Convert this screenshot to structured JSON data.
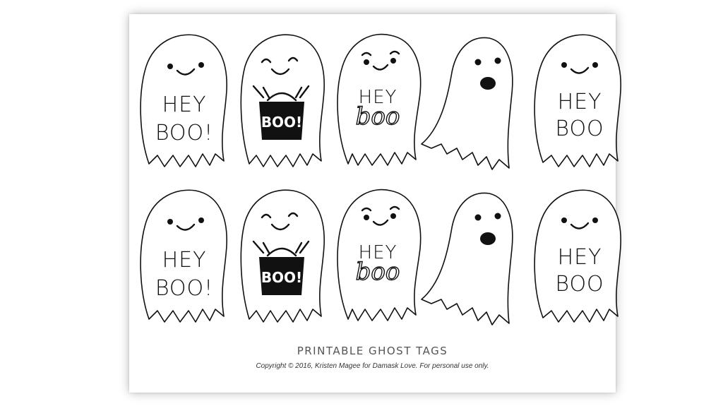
{
  "sheet": {
    "title": "PRINTABLE GHOST TAGS",
    "copyright": "Copyright © 2016, Kristen Magee for Damask Love. For personal use only."
  },
  "ghosts": {
    "heyboo_line1": "HEY",
    "heyboo_line2": "BOO!",
    "bag_text": "BOO!",
    "script_line1": "HEY",
    "script_line2": "boo",
    "plain_line1": "HEY",
    "plain_line2": "BOO"
  },
  "colors": {
    "ink": "#111111",
    "paper": "#ffffff"
  }
}
